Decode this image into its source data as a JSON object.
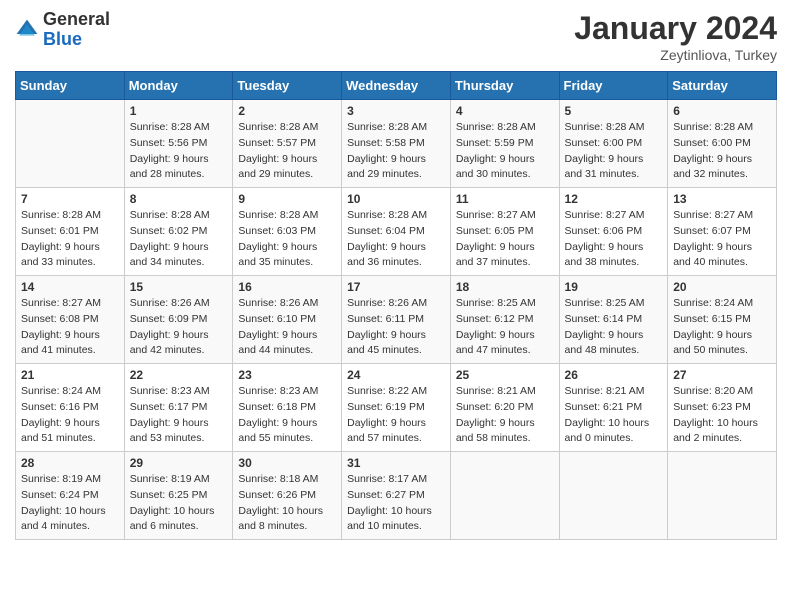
{
  "logo": {
    "general": "General",
    "blue": "Blue"
  },
  "title": "January 2024",
  "subtitle": "Zeytinliova, Turkey",
  "days_of_week": [
    "Sunday",
    "Monday",
    "Tuesday",
    "Wednesday",
    "Thursday",
    "Friday",
    "Saturday"
  ],
  "weeks": [
    [
      {
        "day": "",
        "sunrise": "",
        "sunset": "",
        "daylight": ""
      },
      {
        "day": "1",
        "sunrise": "Sunrise: 8:28 AM",
        "sunset": "Sunset: 5:56 PM",
        "daylight": "Daylight: 9 hours and 28 minutes."
      },
      {
        "day": "2",
        "sunrise": "Sunrise: 8:28 AM",
        "sunset": "Sunset: 5:57 PM",
        "daylight": "Daylight: 9 hours and 29 minutes."
      },
      {
        "day": "3",
        "sunrise": "Sunrise: 8:28 AM",
        "sunset": "Sunset: 5:58 PM",
        "daylight": "Daylight: 9 hours and 29 minutes."
      },
      {
        "day": "4",
        "sunrise": "Sunrise: 8:28 AM",
        "sunset": "Sunset: 5:59 PM",
        "daylight": "Daylight: 9 hours and 30 minutes."
      },
      {
        "day": "5",
        "sunrise": "Sunrise: 8:28 AM",
        "sunset": "Sunset: 6:00 PM",
        "daylight": "Daylight: 9 hours and 31 minutes."
      },
      {
        "day": "6",
        "sunrise": "Sunrise: 8:28 AM",
        "sunset": "Sunset: 6:00 PM",
        "daylight": "Daylight: 9 hours and 32 minutes."
      }
    ],
    [
      {
        "day": "7",
        "sunrise": "Sunrise: 8:28 AM",
        "sunset": "Sunset: 6:01 PM",
        "daylight": "Daylight: 9 hours and 33 minutes."
      },
      {
        "day": "8",
        "sunrise": "Sunrise: 8:28 AM",
        "sunset": "Sunset: 6:02 PM",
        "daylight": "Daylight: 9 hours and 34 minutes."
      },
      {
        "day": "9",
        "sunrise": "Sunrise: 8:28 AM",
        "sunset": "Sunset: 6:03 PM",
        "daylight": "Daylight: 9 hours and 35 minutes."
      },
      {
        "day": "10",
        "sunrise": "Sunrise: 8:28 AM",
        "sunset": "Sunset: 6:04 PM",
        "daylight": "Daylight: 9 hours and 36 minutes."
      },
      {
        "day": "11",
        "sunrise": "Sunrise: 8:27 AM",
        "sunset": "Sunset: 6:05 PM",
        "daylight": "Daylight: 9 hours and 37 minutes."
      },
      {
        "day": "12",
        "sunrise": "Sunrise: 8:27 AM",
        "sunset": "Sunset: 6:06 PM",
        "daylight": "Daylight: 9 hours and 38 minutes."
      },
      {
        "day": "13",
        "sunrise": "Sunrise: 8:27 AM",
        "sunset": "Sunset: 6:07 PM",
        "daylight": "Daylight: 9 hours and 40 minutes."
      }
    ],
    [
      {
        "day": "14",
        "sunrise": "Sunrise: 8:27 AM",
        "sunset": "Sunset: 6:08 PM",
        "daylight": "Daylight: 9 hours and 41 minutes."
      },
      {
        "day": "15",
        "sunrise": "Sunrise: 8:26 AM",
        "sunset": "Sunset: 6:09 PM",
        "daylight": "Daylight: 9 hours and 42 minutes."
      },
      {
        "day": "16",
        "sunrise": "Sunrise: 8:26 AM",
        "sunset": "Sunset: 6:10 PM",
        "daylight": "Daylight: 9 hours and 44 minutes."
      },
      {
        "day": "17",
        "sunrise": "Sunrise: 8:26 AM",
        "sunset": "Sunset: 6:11 PM",
        "daylight": "Daylight: 9 hours and 45 minutes."
      },
      {
        "day": "18",
        "sunrise": "Sunrise: 8:25 AM",
        "sunset": "Sunset: 6:12 PM",
        "daylight": "Daylight: 9 hours and 47 minutes."
      },
      {
        "day": "19",
        "sunrise": "Sunrise: 8:25 AM",
        "sunset": "Sunset: 6:14 PM",
        "daylight": "Daylight: 9 hours and 48 minutes."
      },
      {
        "day": "20",
        "sunrise": "Sunrise: 8:24 AM",
        "sunset": "Sunset: 6:15 PM",
        "daylight": "Daylight: 9 hours and 50 minutes."
      }
    ],
    [
      {
        "day": "21",
        "sunrise": "Sunrise: 8:24 AM",
        "sunset": "Sunset: 6:16 PM",
        "daylight": "Daylight: 9 hours and 51 minutes."
      },
      {
        "day": "22",
        "sunrise": "Sunrise: 8:23 AM",
        "sunset": "Sunset: 6:17 PM",
        "daylight": "Daylight: 9 hours and 53 minutes."
      },
      {
        "day": "23",
        "sunrise": "Sunrise: 8:23 AM",
        "sunset": "Sunset: 6:18 PM",
        "daylight": "Daylight: 9 hours and 55 minutes."
      },
      {
        "day": "24",
        "sunrise": "Sunrise: 8:22 AM",
        "sunset": "Sunset: 6:19 PM",
        "daylight": "Daylight: 9 hours and 57 minutes."
      },
      {
        "day": "25",
        "sunrise": "Sunrise: 8:21 AM",
        "sunset": "Sunset: 6:20 PM",
        "daylight": "Daylight: 9 hours and 58 minutes."
      },
      {
        "day": "26",
        "sunrise": "Sunrise: 8:21 AM",
        "sunset": "Sunset: 6:21 PM",
        "daylight": "Daylight: 10 hours and 0 minutes."
      },
      {
        "day": "27",
        "sunrise": "Sunrise: 8:20 AM",
        "sunset": "Sunset: 6:23 PM",
        "daylight": "Daylight: 10 hours and 2 minutes."
      }
    ],
    [
      {
        "day": "28",
        "sunrise": "Sunrise: 8:19 AM",
        "sunset": "Sunset: 6:24 PM",
        "daylight": "Daylight: 10 hours and 4 minutes."
      },
      {
        "day": "29",
        "sunrise": "Sunrise: 8:19 AM",
        "sunset": "Sunset: 6:25 PM",
        "daylight": "Daylight: 10 hours and 6 minutes."
      },
      {
        "day": "30",
        "sunrise": "Sunrise: 8:18 AM",
        "sunset": "Sunset: 6:26 PM",
        "daylight": "Daylight: 10 hours and 8 minutes."
      },
      {
        "day": "31",
        "sunrise": "Sunrise: 8:17 AM",
        "sunset": "Sunset: 6:27 PM",
        "daylight": "Daylight: 10 hours and 10 minutes."
      },
      {
        "day": "",
        "sunrise": "",
        "sunset": "",
        "daylight": ""
      },
      {
        "day": "",
        "sunrise": "",
        "sunset": "",
        "daylight": ""
      },
      {
        "day": "",
        "sunrise": "",
        "sunset": "",
        "daylight": ""
      }
    ]
  ]
}
